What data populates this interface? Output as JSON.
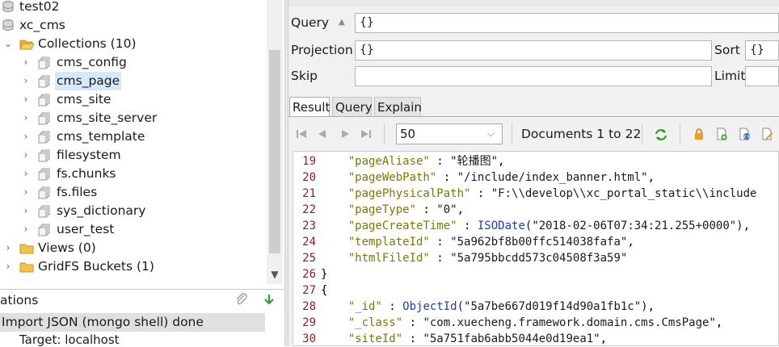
{
  "tree": {
    "items": [
      {
        "label": "test02",
        "kind": "db",
        "indent": 0
      },
      {
        "label": "xc_cms",
        "kind": "db",
        "indent": 0
      },
      {
        "label": "Collections (10)",
        "kind": "folder-open",
        "indent": 1
      },
      {
        "label": "cms_config",
        "kind": "collection",
        "indent": 2
      },
      {
        "label": "cms_page",
        "kind": "collection",
        "indent": 2,
        "selected": true
      },
      {
        "label": "cms_site",
        "kind": "collection",
        "indent": 2
      },
      {
        "label": "cms_site_server",
        "kind": "collection",
        "indent": 2
      },
      {
        "label": "cms_template",
        "kind": "collection",
        "indent": 2
      },
      {
        "label": "filesystem",
        "kind": "collection",
        "indent": 2
      },
      {
        "label": "fs.chunks",
        "kind": "collection",
        "indent": 2
      },
      {
        "label": "fs.files",
        "kind": "collection",
        "indent": 2
      },
      {
        "label": "sys_dictionary",
        "kind": "collection",
        "indent": 2
      },
      {
        "label": "user_test",
        "kind": "collection",
        "indent": 2
      },
      {
        "label": "Views (0)",
        "kind": "folder",
        "indent": 1
      },
      {
        "label": "GridFS Buckets (1)",
        "kind": "folder",
        "indent": 1
      }
    ]
  },
  "operations": {
    "title": "ations",
    "item": "Import JSON (mongo shell) done",
    "target": "Target: localhost"
  },
  "query_panel": {
    "query_label": "Query",
    "query_value": "{}",
    "projection_label": "Projection",
    "projection_value": "{}",
    "sort_label": "Sort",
    "sort_value": "{}",
    "skip_label": "Skip",
    "skip_value": "",
    "limit_label": "Limit"
  },
  "result_tabs": [
    "Result",
    "Query",
    "Explain"
  ],
  "pager": {
    "page_size": "50",
    "documents_label": "Documents 1 to 22"
  },
  "editor_lines": [
    {
      "n": "19",
      "indent": "    ",
      "key": "\"pageAliase\"",
      "sep": " : ",
      "val": "\"轮播图\"",
      "tail": ","
    },
    {
      "n": "20",
      "indent": "    ",
      "key": "\"pageWebPath\"",
      "sep": " : ",
      "val": "\"/include/index_banner.html\"",
      "tail": ","
    },
    {
      "n": "21",
      "indent": "    ",
      "key": "\"pagePhysicalPath\"",
      "sep": " : ",
      "val": "\"F:\\\\develop\\\\xc_portal_static\\\\include",
      "tail": ""
    },
    {
      "n": "22",
      "indent": "    ",
      "key": "\"pageType\"",
      "sep": " : ",
      "val": "\"0\"",
      "tail": ","
    },
    {
      "n": "23",
      "indent": "    ",
      "key": "\"pageCreateTime\"",
      "sep": " : ",
      "fn": "ISODate",
      "val": "(\"2018-02-06T07:34:21.255+0000\")",
      "tail": ","
    },
    {
      "n": "24",
      "indent": "    ",
      "key": "\"templateId\"",
      "sep": " : ",
      "val": "\"5a962bf8b00ffc514038fafa\"",
      "tail": ","
    },
    {
      "n": "25",
      "indent": "    ",
      "key": "\"htmlFileId\"",
      "sep": " : ",
      "val": "\"5a795bbcdd573c04508f3a59\"",
      "tail": ""
    },
    {
      "n": "26",
      "indent": "",
      "punct": "}"
    },
    {
      "n": "27",
      "indent": "",
      "punct": "{"
    },
    {
      "n": "28",
      "indent": "    ",
      "key": "\"_id\"",
      "sep": " : ",
      "fn": "ObjectId",
      "val": "(\"5a7be667d019f14d90a1fb1c\")",
      "tail": ","
    },
    {
      "n": "29",
      "indent": "    ",
      "key": "\"_class\"",
      "sep": " : ",
      "val": "\"com.xuecheng.framework.domain.cms.CmsPage\"",
      "tail": ","
    },
    {
      "n": "30",
      "indent": "    ",
      "key": "\"siteId\"",
      "sep": " : ",
      "val": "\"5a751fab6abb5044e0d19ea1\"",
      "tail": ","
    }
  ]
}
